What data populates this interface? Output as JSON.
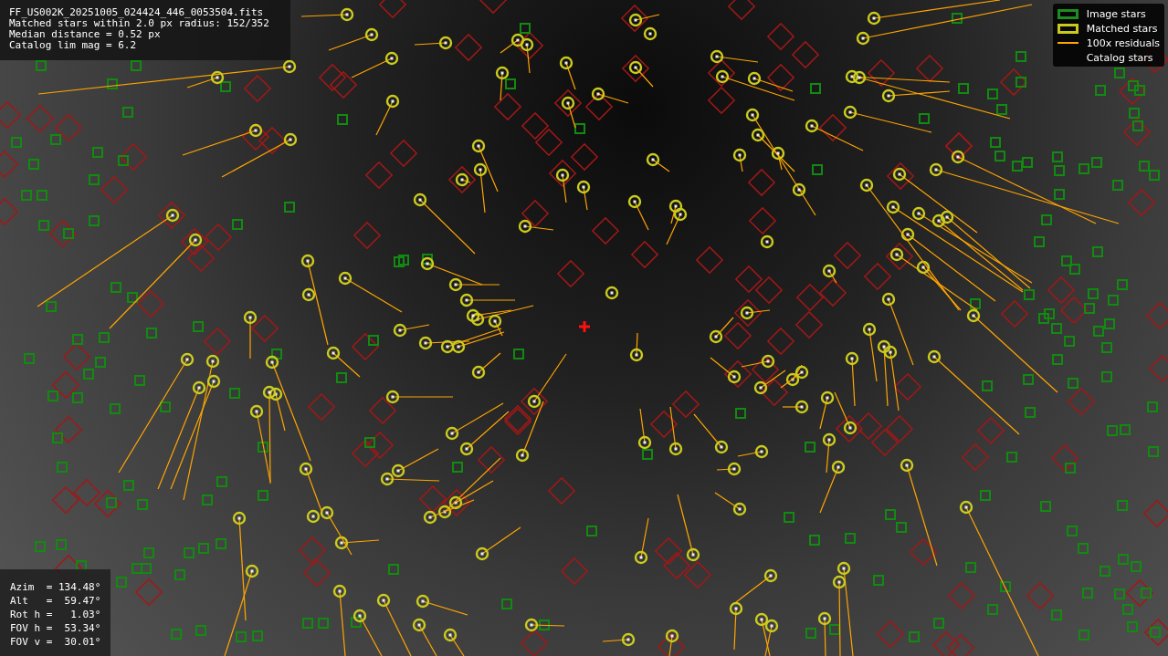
{
  "info_box": {
    "lines": [
      "FF_US002K_20251005_024424_446_0053504.fits",
      "Matched stars within 2.0 px radius: 152/352",
      "Median distance = 0.52 px",
      "Catalog lim mag = 6.2"
    ]
  },
  "legend": {
    "items": [
      {
        "label": "Image stars",
        "kind": "box",
        "color": "#1e8c1e"
      },
      {
        "label": "Matched stars",
        "kind": "box",
        "color": "#c8c81e"
      },
      {
        "label": "100x residuals",
        "kind": "line",
        "color": "#ffa500"
      },
      {
        "label": "Catalog stars",
        "kind": "blank"
      }
    ]
  },
  "pointing_box": {
    "lines": [
      "Azim  = 134.48°",
      "Alt   =  59.47°",
      "Rot h =   1.03°",
      "FOV h =  53.34°",
      "FOV v =  30.01°"
    ]
  }
}
